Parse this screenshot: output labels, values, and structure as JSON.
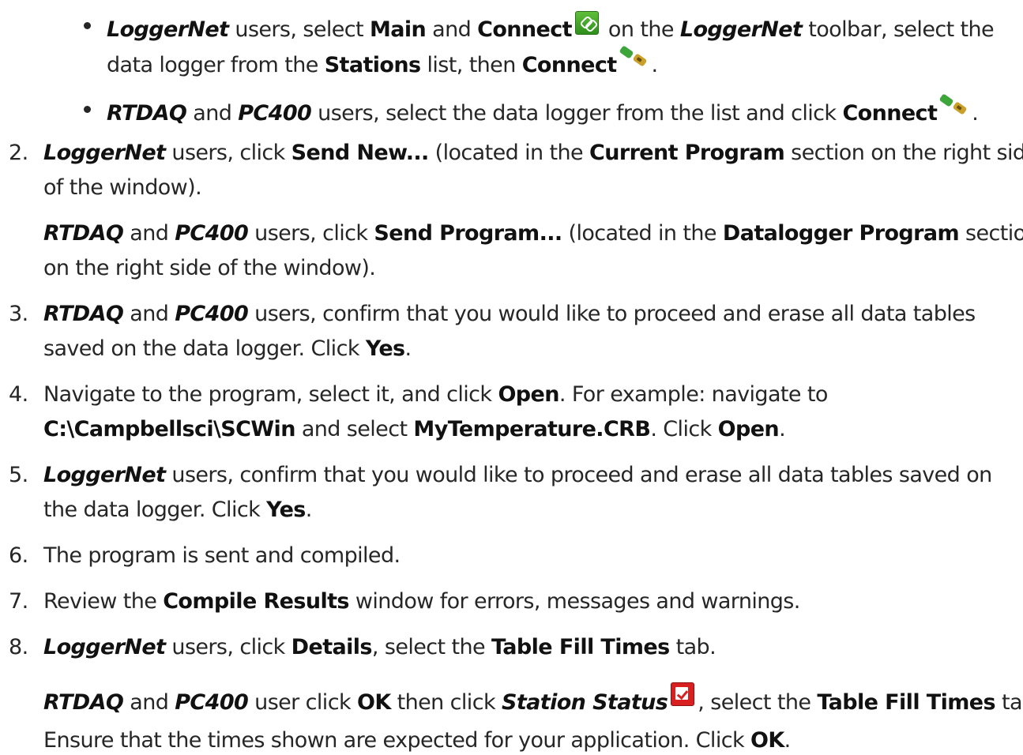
{
  "bullets": [
    {
      "lines": [
        [
          "",
          "LoggerNet",
          " users, select ",
          "Main",
          " and ",
          "Connect",
          "",
          " on the ",
          "LoggerNet",
          " toolbar, select the"
        ],
        [
          "data logger from the ",
          "Stations",
          " list, then ",
          "Connect",
          "."
        ]
      ]
    },
    {
      "lines": [
        [
          "",
          "RTDAQ",
          " and ",
          "PC400",
          " users, select the data logger from the list and click ",
          "Connect",
          "."
        ]
      ]
    }
  ],
  "steps": [
    {
      "num": "2.",
      "lines": [
        [
          "LoggerNet",
          " users, click ",
          "Send New...",
          " (located in the ",
          "Current Program",
          " section on the right side"
        ],
        [
          "of the window)."
        ]
      ],
      "sub": [
        [
          "RTDAQ",
          " and ",
          "PC400",
          " users, click ",
          "Send Program...",
          " (located in the ",
          "Datalogger Program",
          " section"
        ],
        [
          "on the right side of the window)."
        ]
      ]
    },
    {
      "num": "3.",
      "lines": [
        [
          "RTDAQ",
          " and ",
          "PC400",
          " users, confirm that you would like to proceed and erase all data tables"
        ],
        [
          "saved on the data logger. Click ",
          "Yes",
          "."
        ]
      ]
    },
    {
      "num": "4.",
      "lines": [
        [
          "Navigate to the program, select it, and click ",
          "Open",
          ". For example: navigate to"
        ],
        [
          "C:\\Campbellsci\\SCWin",
          " and select ",
          "MyTemperature.CRB",
          ". Click ",
          "Open",
          "."
        ]
      ]
    },
    {
      "num": "5.",
      "lines": [
        [
          "LoggerNet",
          " users, confirm that you would like to proceed and erase all data tables saved on"
        ],
        [
          "the data logger. Click ",
          "Yes",
          "."
        ]
      ]
    },
    {
      "num": "6.",
      "lines": [
        [
          "The program is sent and compiled."
        ]
      ]
    },
    {
      "num": "7.",
      "lines": [
        [
          "Review the ",
          "Compile Results",
          " window for errors, messages and warnings."
        ]
      ]
    },
    {
      "num": "8.",
      "lines": [
        [
          "LoggerNet",
          " users, click ",
          "Details",
          ", select the ",
          "Table Fill Times",
          " tab."
        ]
      ],
      "sub": [
        [
          "RTDAQ",
          " and ",
          "PC400",
          " user click ",
          "OK",
          " then click ",
          "Station Status",
          ", select the ",
          "Table Fill Times",
          " tab."
        ],
        [
          "Ensure that the times shown are expected for your application. Click ",
          "OK",
          "."
        ]
      ]
    }
  ],
  "icons": {
    "connect_toolbar": "link-icon",
    "connect_plug": "plug-icon",
    "station_status": "station-status-icon"
  }
}
